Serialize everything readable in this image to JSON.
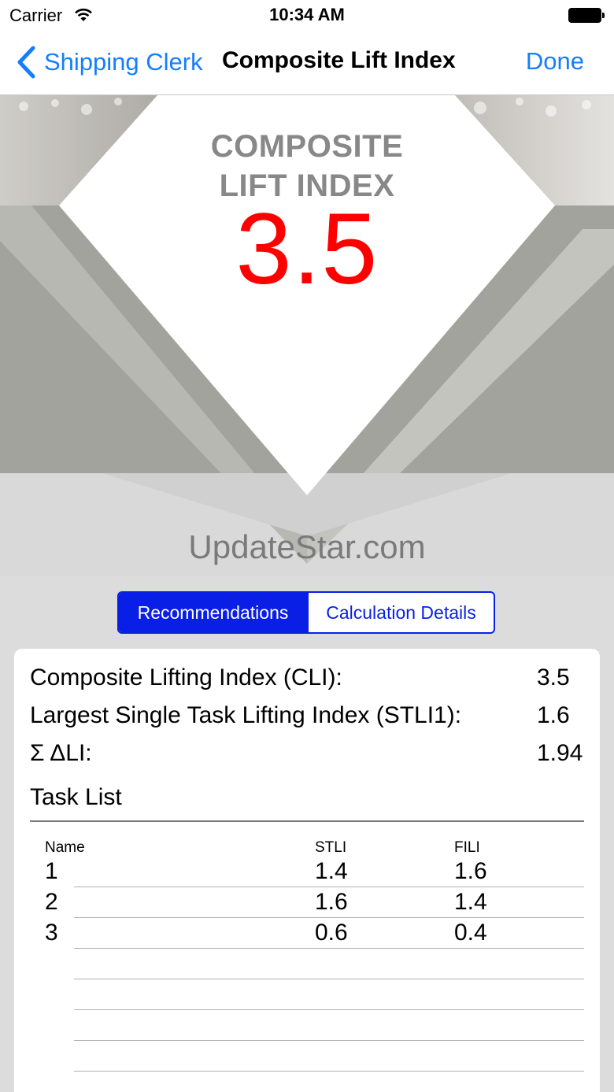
{
  "status_bar": {
    "carrier": "Carrier",
    "time": "10:34 AM"
  },
  "nav": {
    "back_label": "Shipping Clerk",
    "title": "Composite Lift Index",
    "done_label": "Done",
    "accent_color": "#157efb"
  },
  "hero": {
    "heading_line1": "COMPOSITE",
    "heading_line2": "LIFT INDEX",
    "value": "3.5",
    "value_color": "#ff0000"
  },
  "watermark": "UpdateStar.com",
  "segmented_control": {
    "accent_color": "#0a1fe6",
    "segments": [
      {
        "label": "Recommendations",
        "selected": true
      },
      {
        "label": "Calculation Details",
        "selected": false
      }
    ]
  },
  "summary": [
    {
      "label": "Composite Lifting Index (CLI):",
      "value": "3.5"
    },
    {
      "label": "Largest Single Task Lifting Index (STLI1):",
      "value": "1.6"
    },
    {
      "label": "Σ ΔLI:",
      "value": "1.94"
    }
  ],
  "task_list": {
    "title": "Task List",
    "columns": [
      "Name",
      "STLI",
      "FILI"
    ],
    "rows": [
      {
        "name": "1",
        "stli": "1.4",
        "fili": "1.6"
      },
      {
        "name": "2",
        "stli": "1.6",
        "fili": "1.4"
      },
      {
        "name": "3",
        "stli": "0.6",
        "fili": "0.4"
      }
    ]
  }
}
